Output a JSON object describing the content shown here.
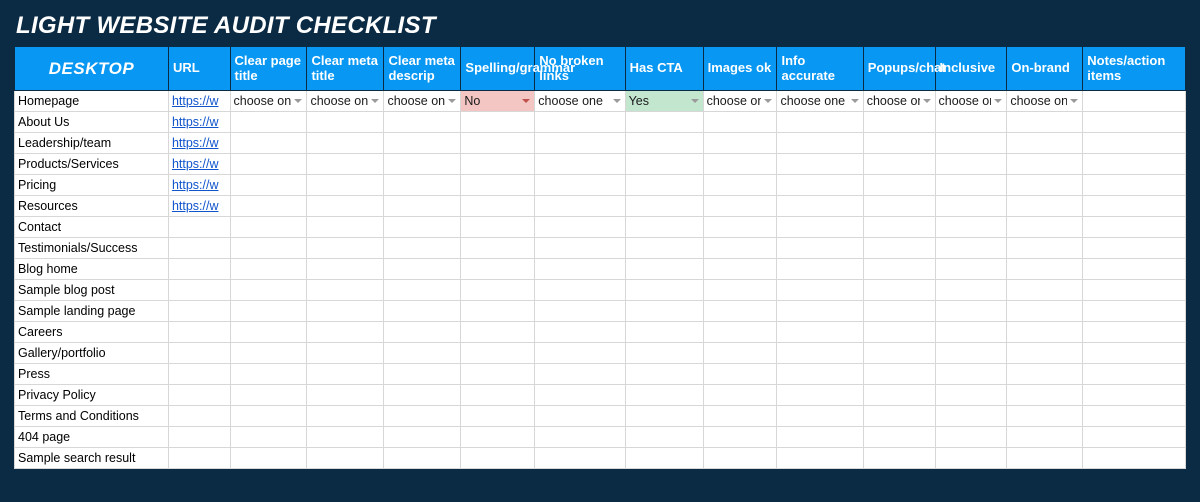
{
  "title": "LIGHT WEBSITE AUDIT CHECKLIST",
  "section_label": "DESKTOP",
  "headers": {
    "url": "URL",
    "clear_page_title": "Clear page title",
    "clear_meta_title": "Clear meta title",
    "clear_meta_descrip": "Clear meta descrip",
    "spelling_grammar": "Spelling/grammar",
    "no_broken_links": "No broken links",
    "has_cta": "Has CTA",
    "images_ok": "Images ok",
    "info_accurate": "Info accurate",
    "popups_chat": "Popups/chat",
    "inclusive": "Inclusive",
    "on_brand": "On-brand",
    "notes": "Notes/action items"
  },
  "dropdown_placeholder": "choose one",
  "status_no": "No",
  "status_yes": "Yes",
  "url_cells": {
    "r0": "https://w",
    "r1": "https://w",
    "r2": "https://w",
    "r3": "https://w",
    "r4": "https://w",
    "r5": "https://w"
  },
  "pages": [
    "Homepage",
    "About Us",
    "Leadership/team",
    "Products/Services",
    "Pricing",
    "Resources",
    "Contact",
    "Testimonials/Success",
    "Blog home",
    "Sample blog post",
    "Sample landing page",
    "Careers",
    "Gallery/portfolio",
    "Press",
    "Privacy Policy",
    "Terms and Conditions",
    "404 page",
    "Sample search result"
  ],
  "colors": {
    "page_bg": "#0b2b45",
    "header_bg": "#0897f2",
    "cell_red": "#f3c6c3",
    "cell_green": "#c3e6cf",
    "link": "#1155cc"
  }
}
